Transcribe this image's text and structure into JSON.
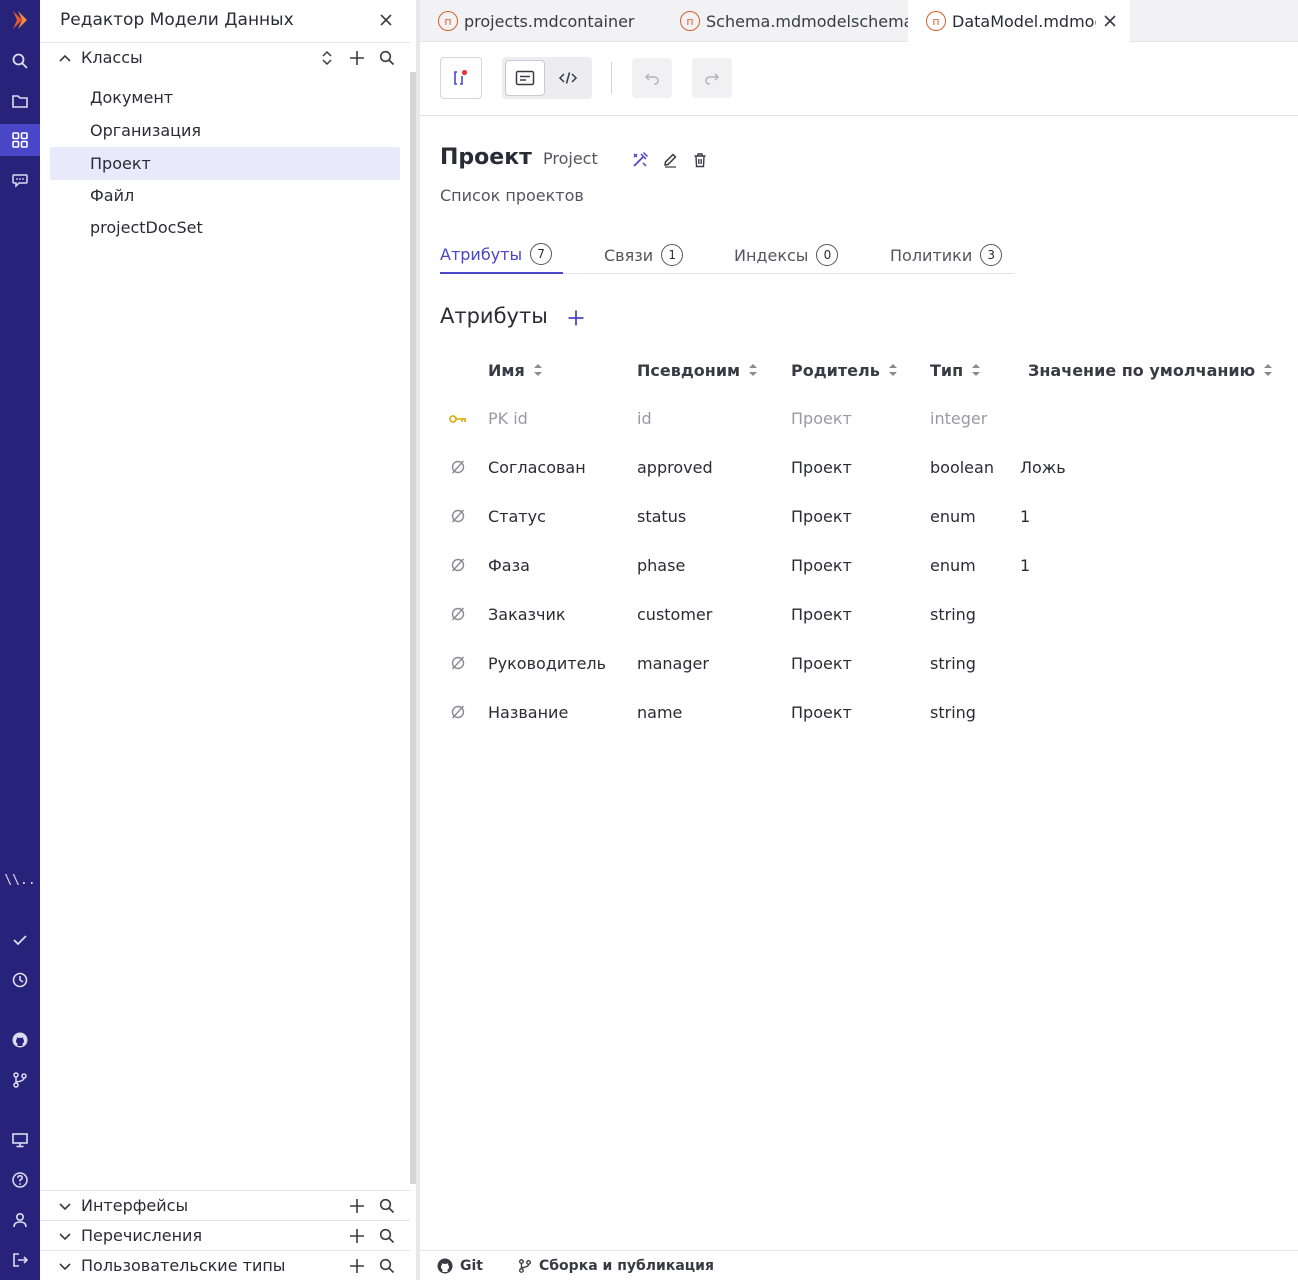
{
  "activity_bar": {
    "icons": [
      "logo-icon",
      "search-icon",
      "folder-icon",
      "grid-icon",
      "chat-icon",
      "ellipsis-icon",
      "check-icon",
      "history-icon",
      "github-icon",
      "branch-icon",
      "monitor-icon",
      "help-icon",
      "user-icon",
      "logout-icon"
    ],
    "abbrev_text": "\\\\..",
    "accent": "#27237a",
    "active_color": "#4a46c8"
  },
  "sidebar": {
    "title": "Редактор Модели Данных",
    "sections": {
      "classes": "Классы",
      "interfaces": "Интерфейсы",
      "enums": "Перечисления",
      "user_types": "Пользовательские типы"
    },
    "items": [
      "Документ",
      "Организация",
      "Проект",
      "Файл",
      "projectDocSet"
    ],
    "selected_item": "Проект"
  },
  "tabs": [
    {
      "badge": "п",
      "label": "projects.mdcontainer"
    },
    {
      "badge": "п",
      "label": "Schema.mdmodelschema"
    },
    {
      "badge": "п",
      "label": "DataModel.mdmodel"
    }
  ],
  "class": {
    "name": "Проект",
    "alias": "Project",
    "description": "Список проектов"
  },
  "subtabs": [
    {
      "label": "Атрибуты",
      "count": "7"
    },
    {
      "label": "Связи",
      "count": "1"
    },
    {
      "label": "Индексы",
      "count": "0"
    },
    {
      "label": "Политики",
      "count": "3"
    }
  ],
  "attributes": {
    "title": "Атрибуты",
    "columns": [
      "Имя",
      "Псевдоним",
      "Родитель",
      "Тип",
      "Значение по умолчанию"
    ],
    "rows": [
      {
        "icon": "key-icon",
        "name": "PK id",
        "alias": "id",
        "parent": "Проект",
        "type": "integer",
        "default": "",
        "muted": true
      },
      {
        "icon": "nullable-icon",
        "name": "Согласован",
        "alias": "approved",
        "parent": "Проект",
        "type": "boolean",
        "default": "Ложь"
      },
      {
        "icon": "nullable-icon",
        "name": "Статус",
        "alias": "status",
        "parent": "Проект",
        "type": "enum",
        "default": "1"
      },
      {
        "icon": "nullable-icon",
        "name": "Фаза",
        "alias": "phase",
        "parent": "Проект",
        "type": "enum",
        "default": "1"
      },
      {
        "icon": "nullable-icon",
        "name": "Заказчик",
        "alias": "customer",
        "parent": "Проект",
        "type": "string",
        "default": ""
      },
      {
        "icon": "nullable-icon",
        "name": "Руководитель",
        "alias": "manager",
        "parent": "Проект",
        "type": "string",
        "default": ""
      },
      {
        "icon": "nullable-icon",
        "name": "Название",
        "alias": "name",
        "parent": "Проект",
        "type": "string",
        "default": ""
      }
    ]
  },
  "statusbar": {
    "git": "Git",
    "build": "Сборка и публикация"
  }
}
